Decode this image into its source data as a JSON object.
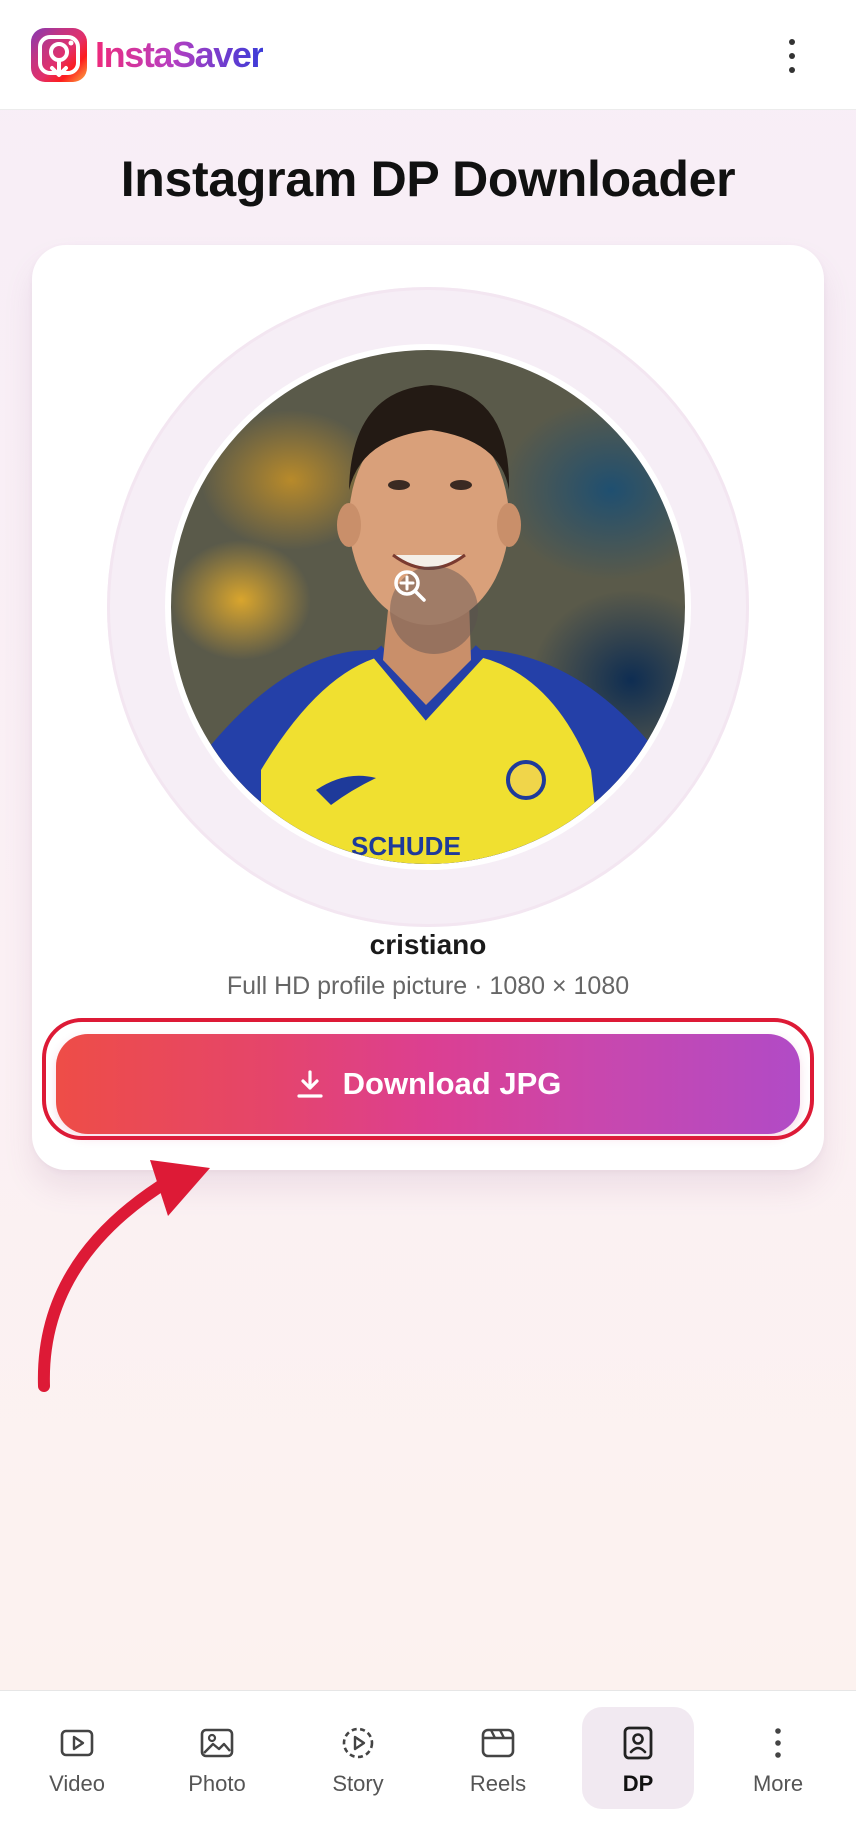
{
  "app": {
    "name": "InstaSaver",
    "logo_icon": "download-camera-icon",
    "menu_icon": "more-vertical-icon"
  },
  "page": {
    "title": "Instagram DP Downloader"
  },
  "profile": {
    "username": "cristiano",
    "subtitle": "Full HD profile picture · 1080 × 1080",
    "zoom_icon": "zoom-in-icon"
  },
  "download": {
    "label": "Download JPG",
    "icon": "download-icon"
  },
  "nav": {
    "items": [
      {
        "label": "Video",
        "icon": "video-icon",
        "active": false
      },
      {
        "label": "Photo",
        "icon": "photo-icon",
        "active": false
      },
      {
        "label": "Story",
        "icon": "story-icon",
        "active": false
      },
      {
        "label": "Reels",
        "icon": "reels-icon",
        "active": false
      },
      {
        "label": "DP",
        "icon": "profile-icon",
        "active": true
      },
      {
        "label": "More",
        "icon": "more-vertical-icon",
        "active": false
      }
    ]
  },
  "colors": {
    "brand_gradient": [
      "#ee4d47",
      "#dc3f91",
      "#b14bc6"
    ],
    "highlight": "#dd1a36",
    "annotation_arrow": "#dd1a36"
  }
}
